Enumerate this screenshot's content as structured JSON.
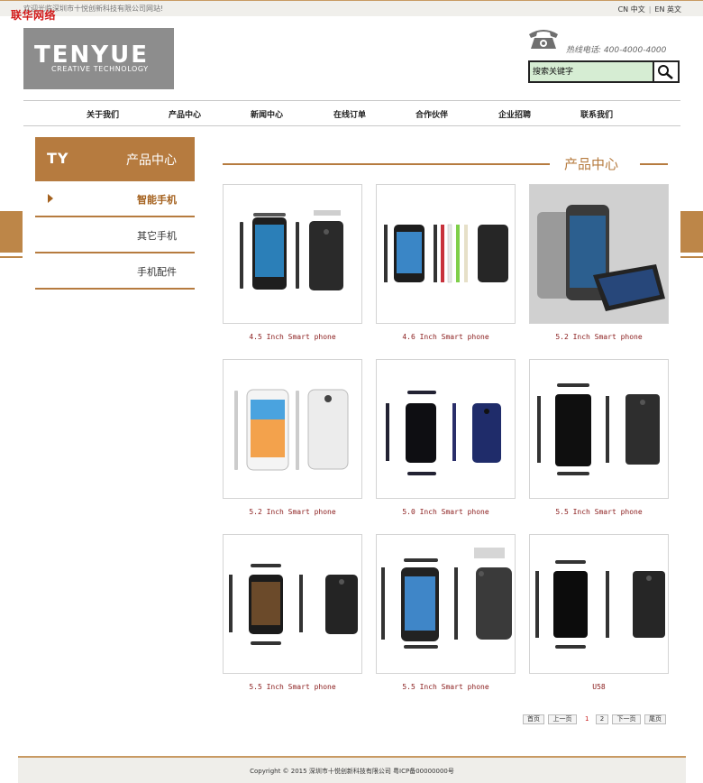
{
  "topbar": {
    "welcome": "欢迎光临深圳市十悦创新科技有限公司网站!",
    "watermark": "联华网络",
    "lang_cn": "CN 中文",
    "lang_en": "EN 英文"
  },
  "logo": {
    "name": "TENYUE",
    "tagline": "CREATIVE TECHNOLOGY"
  },
  "header": {
    "hotline": "热线电话: 400-4000-4000"
  },
  "search": {
    "placeholder": "搜索关键字"
  },
  "nav": {
    "items": [
      "关于我们",
      "产品中心",
      "新闻中心",
      "在线订单",
      "合作伙伴",
      "企业招聘",
      "联系我们"
    ]
  },
  "sidebar": {
    "mark": "TY",
    "title": "产品中心",
    "items": [
      "智能手机",
      "其它手机",
      "手机配件"
    ]
  },
  "main": {
    "title": "产品中心"
  },
  "products": [
    "4.5 Inch Smart phone",
    "4.6 Inch Smart phone",
    "5.2 Inch Smart phone",
    "5.2 Inch Smart phone",
    "5.0 Inch Smart phone",
    "5.5 Inch Smart phone",
    "5.5 Inch Smart phone",
    "5.5 Inch Smart phone",
    "U58"
  ],
  "pager": {
    "first": "首页",
    "prev": "上一页",
    "current": "1",
    "page2": "2",
    "next": "下一页",
    "last": "尾页"
  },
  "footer": {
    "copyright": "Copyright © 2015 深圳市十悦创新科技有限公司 粤ICP备00000000号"
  },
  "colors": {
    "accent": "#b67b3f",
    "caption": "#8a1c1c",
    "search_bg": "#d6edd3"
  }
}
